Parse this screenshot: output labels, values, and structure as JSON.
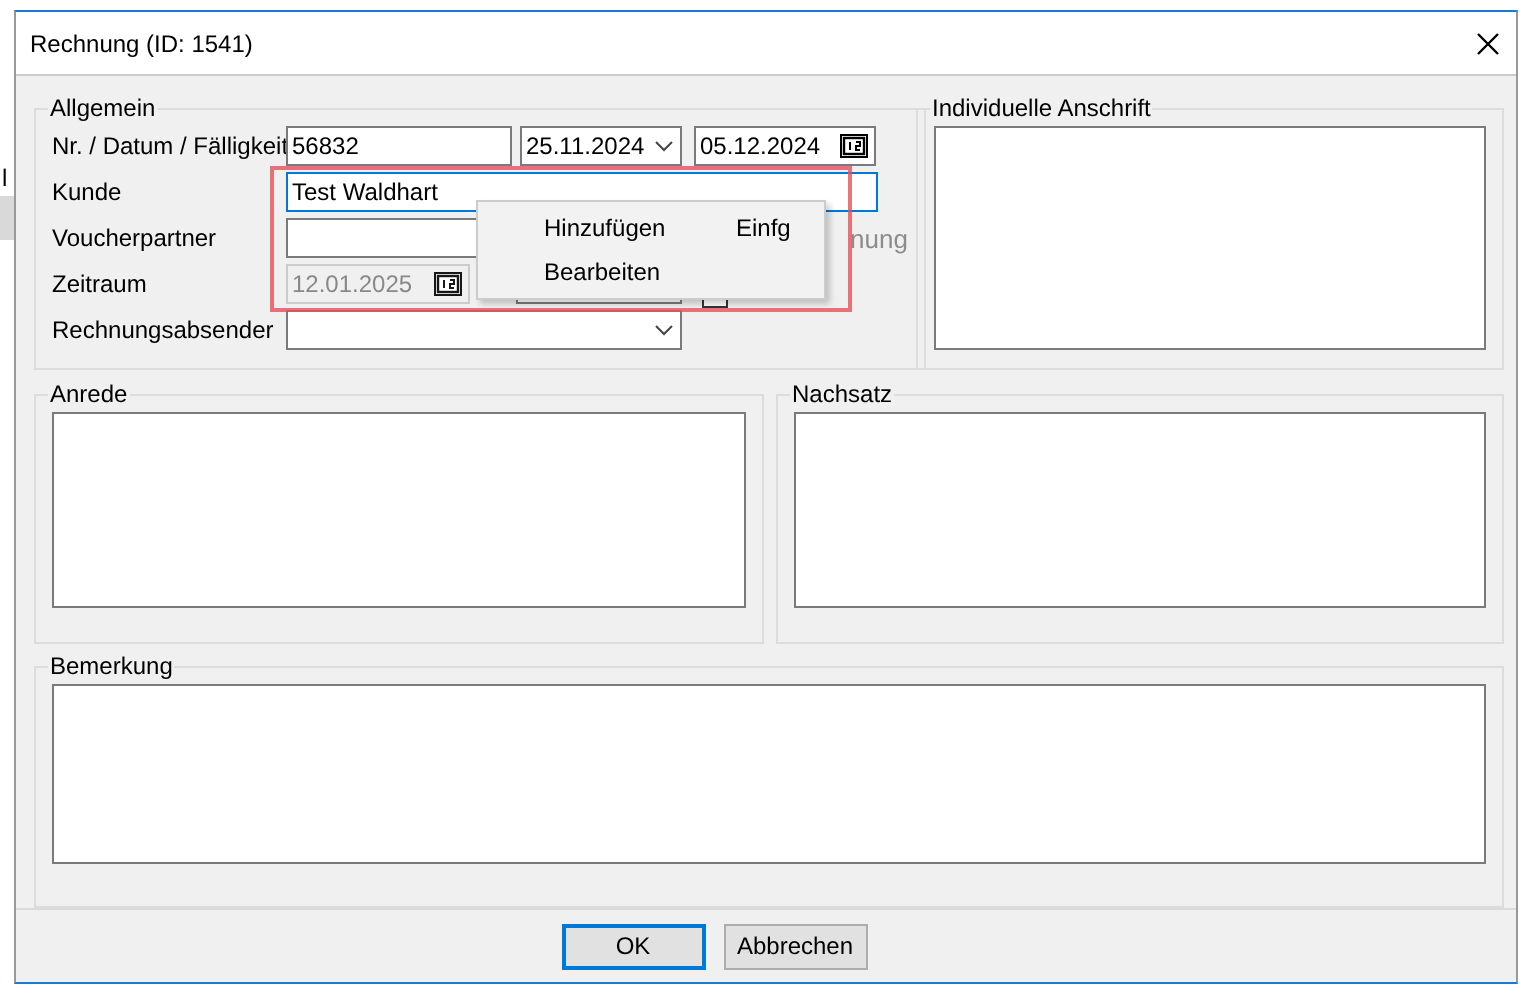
{
  "background": {
    "fragment": "l"
  },
  "window": {
    "title": "Rechnung (ID: 1541)"
  },
  "general": {
    "title": "Allgemein",
    "rows": [
      {
        "kind": "number_dates",
        "label": "Nr. / Datum / Fälligkeit",
        "number": "56832",
        "date": "25.11.2024",
        "due_date": "05.12.2024"
      },
      {
        "kind": "text",
        "label": "Kunde",
        "value": "Test Waldhart",
        "focused": true
      },
      {
        "kind": "text",
        "label": "Voucherpartner",
        "focused": false,
        "note": "nung"
      },
      {
        "kind": "period",
        "label": "Zeitraum",
        "from": "12.01.2025",
        "from_disabled": true,
        "checked": false
      },
      {
        "kind": "dropdown",
        "label": "Rechnungsabsender"
      }
    ]
  },
  "address": {
    "title": "Individuelle Anschrift"
  },
  "salutation": {
    "title": "Anrede"
  },
  "closing": {
    "title": "Nachsatz"
  },
  "remark": {
    "title": "Bemerkung"
  },
  "context_menu": {
    "items": [
      {
        "label": "Hinzufügen",
        "shortcut": "Einfg"
      },
      {
        "label": "Bearbeiten"
      }
    ]
  },
  "buttons": [
    {
      "label": "OK",
      "default": true
    },
    {
      "label": "Abbrechen",
      "default": false
    }
  ]
}
